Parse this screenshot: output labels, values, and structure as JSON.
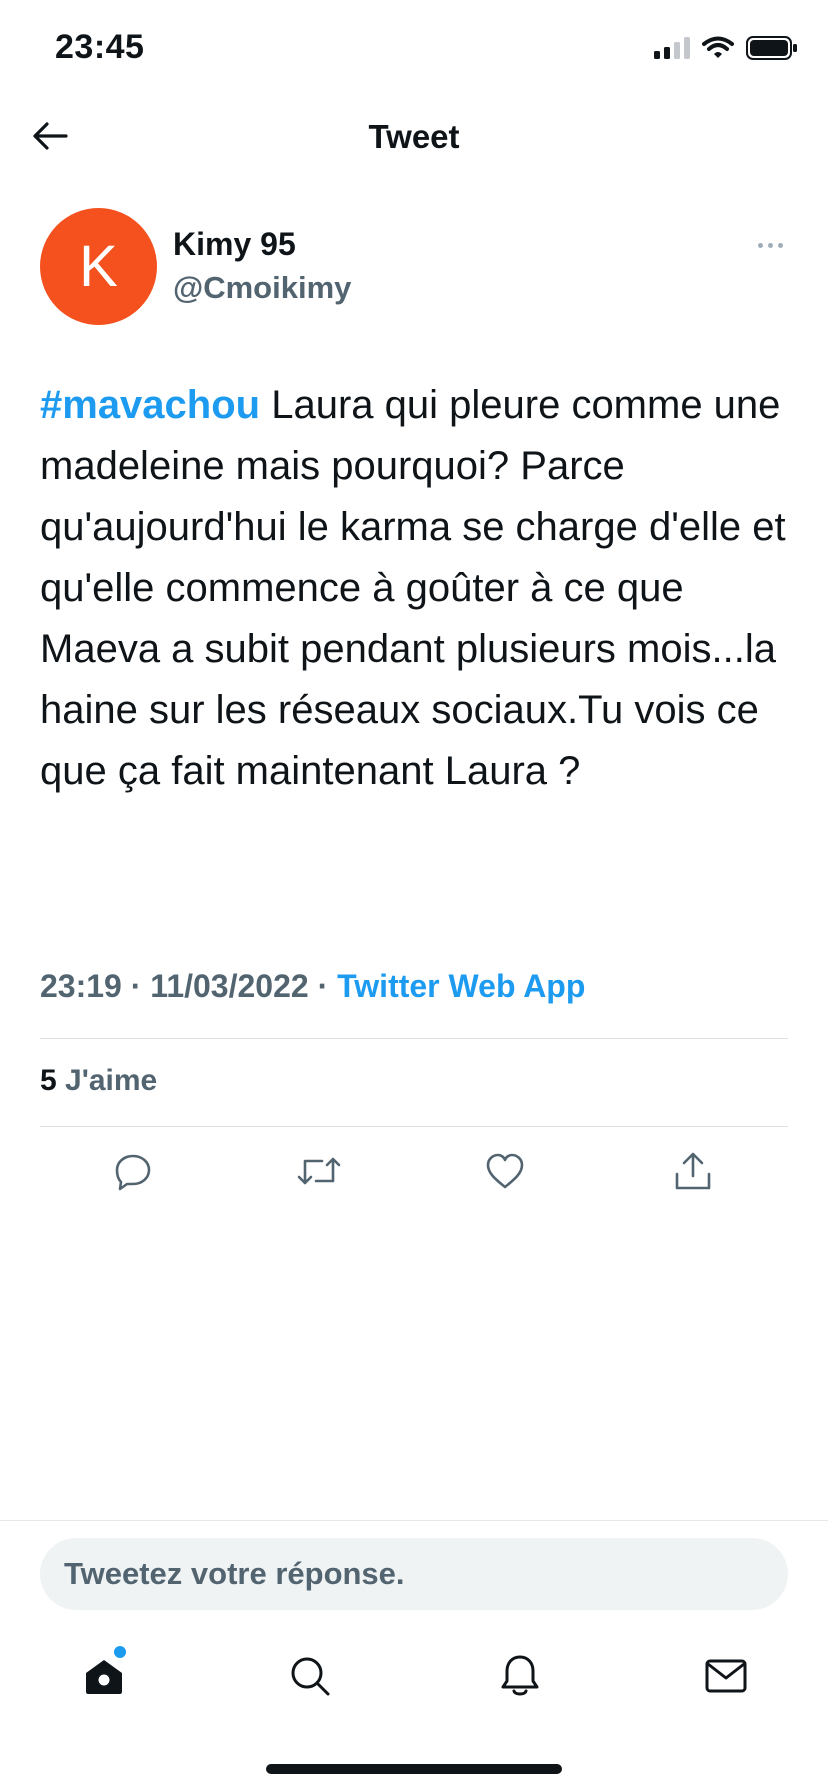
{
  "status_bar": {
    "time": "23:45",
    "icons": [
      "cellular-signal-icon",
      "wifi-icon",
      "battery-icon"
    ]
  },
  "header": {
    "title": "Tweet",
    "back_icon": "arrow-left-icon"
  },
  "tweet": {
    "author": {
      "avatar_letter": "K",
      "avatar_color": "#f4511e",
      "name": "Kimy 95",
      "handle": "@Cmoikimy"
    },
    "hashtag": "#mavachou",
    "text": " Laura qui pleure comme une madeleine mais pourquoi? Parce qu'aujourd'hui le karma se charge d'elle et qu'elle commence à goûter à ce que Maeva a subit pendant plusieurs mois...la haine sur les réseaux sociaux.Tu vois ce que ça fait maintenant Laura ?",
    "time": "23:19",
    "separator": " · ",
    "date": "11/03/2022",
    "source": "Twitter Web App",
    "likes_count": "5",
    "likes_label": " J'aime",
    "actions": [
      "reply-icon",
      "retweet-icon",
      "like-icon",
      "share-icon"
    ]
  },
  "reply": {
    "placeholder": "Tweetez votre réponse."
  },
  "tabbar": {
    "items": [
      "home-icon",
      "search-icon",
      "notifications-icon",
      "messages-icon"
    ],
    "home_has_badge": true
  },
  "colors": {
    "accent": "#1d9bf0",
    "text": "#0f1419",
    "secondary": "#536471"
  }
}
